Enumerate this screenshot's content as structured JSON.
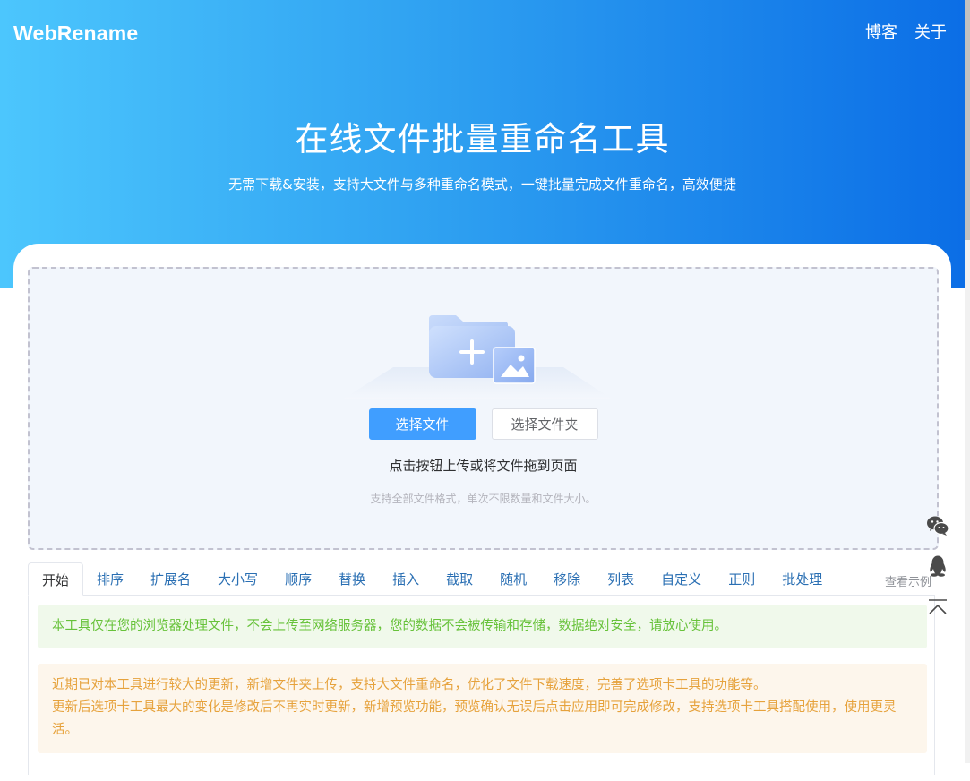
{
  "header": {
    "logo": "WebRename",
    "nav": [
      {
        "label": "博客"
      },
      {
        "label": "关于"
      }
    ]
  },
  "hero": {
    "title": "在线文件批量重命名工具",
    "subtitle": "无需下载&安装，支持大文件与多种重命名模式，一键批量完成文件重命名，高效便捷"
  },
  "upload": {
    "select_files_label": "选择文件",
    "select_folder_label": "选择文件夹",
    "hint": "点击按钮上传或将文件拖到页面",
    "note": "支持全部文件格式，单次不限数量和文件大小。"
  },
  "tabs": {
    "items": [
      {
        "label": "开始",
        "active": true
      },
      {
        "label": "排序"
      },
      {
        "label": "扩展名"
      },
      {
        "label": "大小写"
      },
      {
        "label": "顺序"
      },
      {
        "label": "替换"
      },
      {
        "label": "插入"
      },
      {
        "label": "截取"
      },
      {
        "label": "随机"
      },
      {
        "label": "移除"
      },
      {
        "label": "列表"
      },
      {
        "label": "自定义"
      },
      {
        "label": "正则"
      },
      {
        "label": "批处理"
      }
    ],
    "extra_link": "查看示例"
  },
  "panel": {
    "privacy_notice": "本工具仅在您的浏览器处理文件，不会上传至网络服务器，您的数据不会被传输和存储，数据绝对安全，请放心使用。",
    "update_notice": [
      "近期已对本工具进行较大的更新，新增文件夹上传，支持大文件重命名，优化了文件下载速度，完善了选项卡工具的功能等。",
      "更新后选项卡工具最大的变化是修改后不再实时更新，新增预览功能，预览确认无误后点击应用即可完成修改，支持选项卡工具搭配使用，使用更灵活。"
    ]
  },
  "float_icons": [
    "wechat-icon",
    "qq-icon",
    "back-to-top-icon"
  ],
  "colors": {
    "hero_gradient_start": "#4cc6fd",
    "hero_gradient_end": "#0b6ee6",
    "primary": "#409eff",
    "success_text": "#67c23a",
    "warning_text": "#e6a23c",
    "tab_text": "#2a6fb3"
  }
}
